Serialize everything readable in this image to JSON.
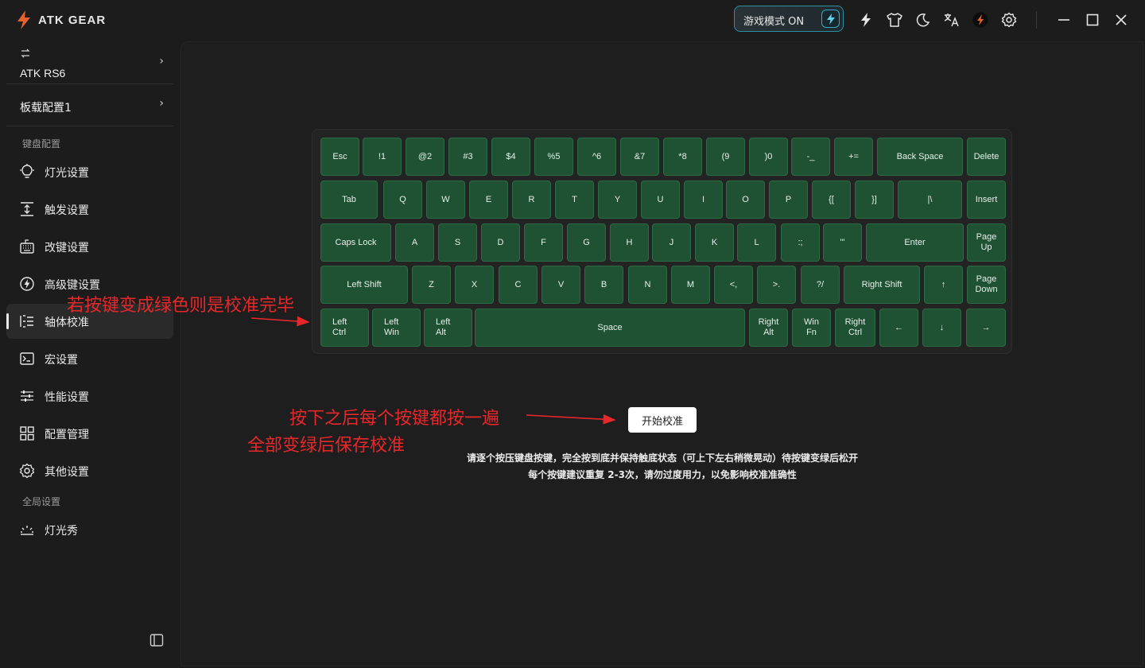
{
  "app": {
    "logo_text": "ATK GEAR"
  },
  "titlebar": {
    "game_mode_label": "游戏模式 ON",
    "icons": [
      "lightning-icon",
      "tshirt-icon",
      "moon-icon",
      "translate-icon",
      "brand-badge-icon",
      "gear-icon"
    ],
    "window_controls": [
      "minimize-icon",
      "maximize-icon",
      "close-icon"
    ]
  },
  "sidebar": {
    "device_name": "ATK RS6",
    "profile_name": "板载配置1",
    "section_keyboard": "键盘配置",
    "items": [
      {
        "label": "灯光设置",
        "icon": "bulb-icon"
      },
      {
        "label": "触发设置",
        "icon": "trigger-icon"
      },
      {
        "label": "改键设置",
        "icon": "keyboard-icon"
      },
      {
        "label": "高级键设置",
        "icon": "bolt-circle-icon"
      },
      {
        "label": "轴体校准",
        "icon": "calibrate-icon",
        "active": true
      },
      {
        "label": "宏设置",
        "icon": "terminal-icon"
      },
      {
        "label": "性能设置",
        "icon": "sliders-icon"
      },
      {
        "label": "配置管理",
        "icon": "grid-icon"
      },
      {
        "label": "其他设置",
        "icon": "cog-icon"
      }
    ],
    "section_global": "全局设置",
    "global_items": [
      {
        "label": "灯光秀",
        "icon": "light-show-icon"
      }
    ]
  },
  "keyboard": {
    "row1": [
      "Esc",
      "!1",
      "@2",
      "#3",
      "$4",
      "%5",
      "^6",
      "&7",
      "*8",
      "(9",
      ")0",
      "-_",
      "+=",
      "Back Space",
      "Delete"
    ],
    "row2": [
      "Tab",
      "Q",
      "W",
      "E",
      "R",
      "T",
      "Y",
      "U",
      "I",
      "O",
      "P",
      "{[",
      "}]",
      "|\\",
      "Insert"
    ],
    "row3": [
      "Caps Lock",
      "A",
      "S",
      "D",
      "F",
      "G",
      "H",
      "J",
      "K",
      "L",
      ":;",
      "\"'",
      "Enter",
      "Page\nUp"
    ],
    "row4": [
      "Left Shift",
      "Z",
      "X",
      "C",
      "V",
      "B",
      "N",
      "M",
      "<,",
      ">.",
      "?/",
      "Right Shift",
      "↑",
      "Page\nDown"
    ],
    "row5": [
      "Left\nCtrl",
      "Left\nWin",
      "Left\nAlt",
      "Space",
      "Right\nAlt",
      "Win\nFn",
      "Right\nCtrl",
      "←",
      "↓",
      "→"
    ]
  },
  "main": {
    "start_button": "开始校准",
    "instruction_line1": "请逐个按压键盘按键，完全按到底并保持触底状态（可上下左右稍微晃动）待按键变绿后松开",
    "instruction_line2": "每个按键建议重复 2-3次，请勿过度用力，以免影响校准准确性"
  },
  "annotations": {
    "green_done": "若按键变成绿色则是校准完毕",
    "press_each": "按下之后每个按键都按一遍",
    "save_after": "全部变绿后保存校准"
  },
  "colors": {
    "key_green": "#1f5233",
    "annotation_red": "#e8272b",
    "accent_cyan": "#36aac6"
  }
}
